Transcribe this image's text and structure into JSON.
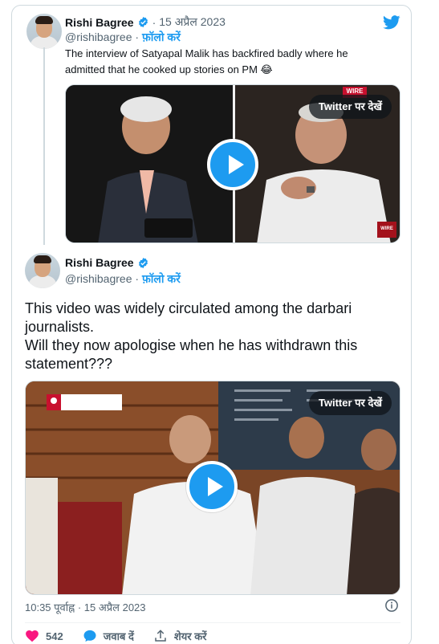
{
  "tweet1": {
    "name": "Rishi Bagree",
    "date": "15 अप्रैल 2023",
    "handle": "@rishibagree",
    "follow": "फ़ॉलो करें",
    "text_line1": "The interview of Satyapal Malik has backfired badly where he",
    "text_line2": "admitted that he cooked up stories on PM 😂",
    "media_button": "Twitter पर देखें",
    "watermark_top": "WIRE",
    "watermark_bottom": "WIRE"
  },
  "tweet2": {
    "name": "Rishi Bagree",
    "handle": "@rishibagree",
    "follow": "फ़ॉलो करें",
    "text_line1": "This video was widely circulated among the darbari",
    "text_line2": "journalists.",
    "text_line3": "Will they now apologise when he has withdrawn this",
    "text_line4": "statement???",
    "media_button": "Twitter पर देखें",
    "timestamp": "10:35 पूर्वाह्न · 15 अप्रैल 2023",
    "likes": "542",
    "reply_label": "जवाब दें",
    "share_label": "शेयर करें"
  },
  "colors": {
    "accent": "#1d9bf0",
    "like": "#f91880",
    "secondary": "#536471"
  },
  "icons": [
    "twitter-bird-icon",
    "verified-badge-icon",
    "play-icon",
    "info-icon",
    "heart-icon",
    "reply-bubble-icon",
    "share-icon"
  ]
}
